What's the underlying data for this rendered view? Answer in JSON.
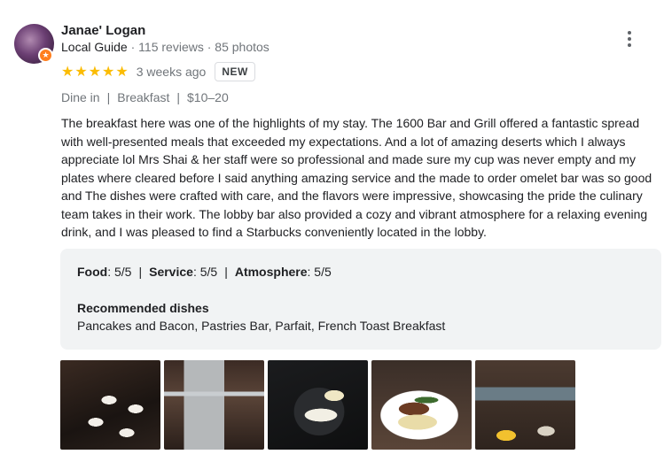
{
  "author": {
    "name": "Janae' Logan",
    "guide_label": "Local Guide",
    "reviews": "115 reviews",
    "photos": "85 photos",
    "separator": " · ",
    "badge_icon": "local-guide-star-icon"
  },
  "rating": {
    "stars": 5,
    "max_stars": 5,
    "star_color": "#fbbc04",
    "time_ago": "3 weeks ago",
    "badge": "NEW"
  },
  "visit": {
    "service": "Dine in",
    "meal": "Breakfast",
    "price": "$10–20",
    "separator": "|"
  },
  "review_text": "The breakfast here was one of the highlights of my stay. The 1600 Bar and Grill offered a fantastic spread with well-presented meals that exceeded my expectations. And a lot of amazing deserts which I always appreciate lol Mrs Shai & her staff were so professional and made sure my cup was never empty and my plates where cleared before I said anything amazing service and the made to order omelet bar was so good and The dishes were crafted with care, and the flavors were impressive, showcasing the pride the culinary team takes in their work. The lobby bar also provided a cozy and vibrant atmosphere for a relaxing evening drink, and I was pleased to find a Starbucks conveniently located in the lobby.",
  "details": {
    "food_label": "Food",
    "food_value": ": 5/5",
    "service_label": "Service",
    "service_value": ": 5/5",
    "atmosphere_label": "Atmosphere",
    "atmosphere_value": ": 5/5",
    "separator": "|",
    "recommended_title": "Recommended dishes",
    "recommended_list": "Pancakes and Bacon, Pastries Bar, Parfait, French Toast Breakfast"
  },
  "photos": [
    "photo-1",
    "photo-2",
    "photo-3",
    "photo-4",
    "photo-5"
  ],
  "icons": {
    "more": "more-vert-icon",
    "star": "star-icon"
  }
}
